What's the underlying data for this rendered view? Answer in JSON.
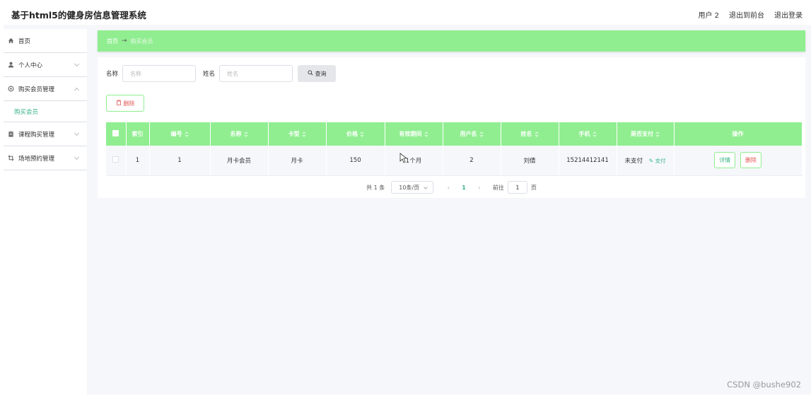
{
  "header": {
    "title": "基于html5的健身房信息管理系统",
    "user": "用户 2",
    "exit_front": "退出到前台",
    "logout": "退出登录"
  },
  "sidebar": {
    "items": [
      {
        "label": "首页",
        "icon": "home-icon"
      },
      {
        "label": "个人中心",
        "icon": "user-icon"
      },
      {
        "label": "购买会员管理",
        "icon": "settings-icon"
      },
      {
        "label": "课程购买管理",
        "icon": "clipboard-icon"
      },
      {
        "label": "场地预约管理",
        "icon": "crop-icon"
      }
    ],
    "sub_item": "购买会员"
  },
  "breadcrumb": {
    "home": "首页",
    "current": "购买会员"
  },
  "search": {
    "name_label": "名称",
    "name_placeholder": "名称",
    "person_label": "姓名",
    "person_placeholder": "姓名",
    "button": "查询"
  },
  "actions": {
    "delete": "删除"
  },
  "table": {
    "headers": [
      "索引",
      "编号",
      "名称",
      "卡型",
      "价格",
      "有效期间",
      "用户名",
      "姓名",
      "手机",
      "是否支付",
      "操作"
    ],
    "rows": [
      {
        "index": "1",
        "number": "1",
        "name": "月卡会员",
        "card_type": "月卡",
        "price": "150",
        "validity": "1个月",
        "username": "2",
        "person": "刘倩",
        "phone": "15214412141",
        "pay_status": "未支付",
        "pay_link": "支付",
        "detail": "详情",
        "delete": "删除"
      }
    ]
  },
  "pagination": {
    "total": "共 1 条",
    "page_size": "10条/页",
    "current_page": "1",
    "goto_label": "前往",
    "goto_value": "1",
    "page_suffix": "页"
  },
  "watermark": "CSDN @bushe902",
  "colors": {
    "accent": "#90ee90",
    "link": "#3bb38a",
    "danger": "#e05555"
  }
}
